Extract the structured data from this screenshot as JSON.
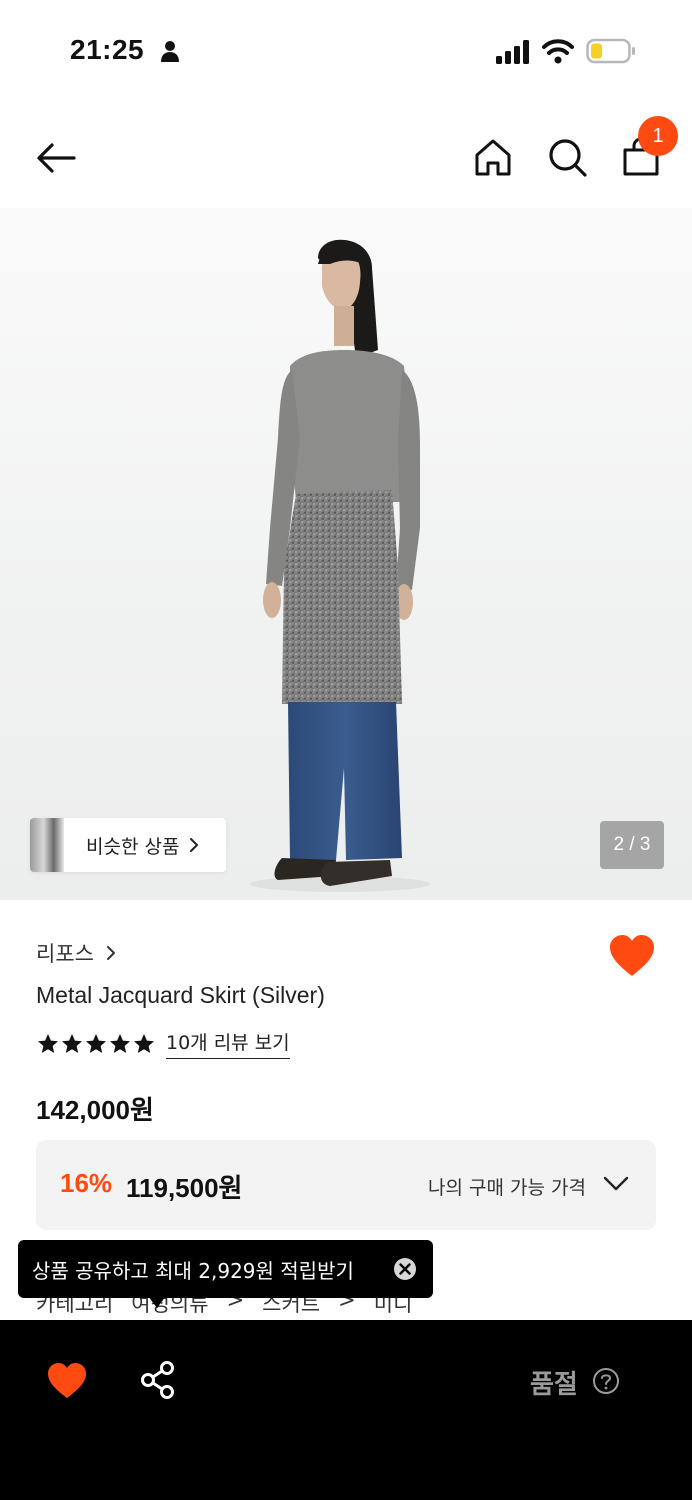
{
  "status_bar": {
    "time": "21:25",
    "battery_color": "#f6d125"
  },
  "nav": {
    "cart_count": "1",
    "accent": "#ff4b12"
  },
  "hero": {
    "similar_products_label": "비슷한 상품",
    "page_indicator": "2 / 3"
  },
  "product": {
    "brand": "리포스",
    "name": "Metal Jacquard Skirt (Silver)",
    "rating_stars": 5,
    "review_link": "10개 리뷰 보기",
    "original_price": "142,000원",
    "discount_rate": "16%",
    "sale_price": "119,500원",
    "my_price_label": "나의 구매 가능 가격",
    "wishlisted": true
  },
  "category": {
    "label": "카테고리",
    "path": [
      "여성의류",
      "스커트",
      "미디"
    ]
  },
  "tooltip": {
    "text": "상품 공유하고 최대 2,929원 적립받기"
  },
  "bottom_bar": {
    "soldout_label": "품절"
  }
}
